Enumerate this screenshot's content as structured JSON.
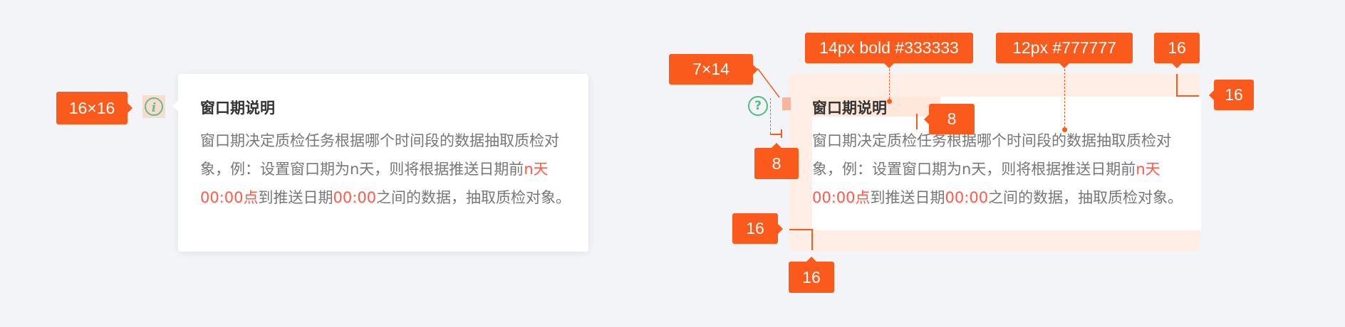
{
  "tooltip": {
    "title": "窗口期说明",
    "body": {
      "p1": "窗口期决定质检任务根据哪个时间段的数据抽取质检对象，例：设置窗口期为n天，则将根据推送日期前",
      "h1": "n天00:00点",
      "p2": "到推送日期",
      "h2": "00:00",
      "p3": "之间的数据，抽取质检对象。"
    },
    "highlight_color": "#ff5a4a"
  },
  "icons": {
    "info": "i",
    "help": "?"
  },
  "annotations": {
    "icon_size": "16×16",
    "arrow_size": "7×14",
    "title_style": "14px bold #333333",
    "body_style": "12px #777777",
    "gap_icon_arrow": "8",
    "gap_title_body": "8",
    "pad_top": "16",
    "pad_right": "16",
    "pad_left": "16",
    "pad_bottom": "16"
  },
  "colors": {
    "accent": "#fa5a1b",
    "title": "#333333",
    "body": "#777777",
    "icon_green": "#6fb98f"
  }
}
